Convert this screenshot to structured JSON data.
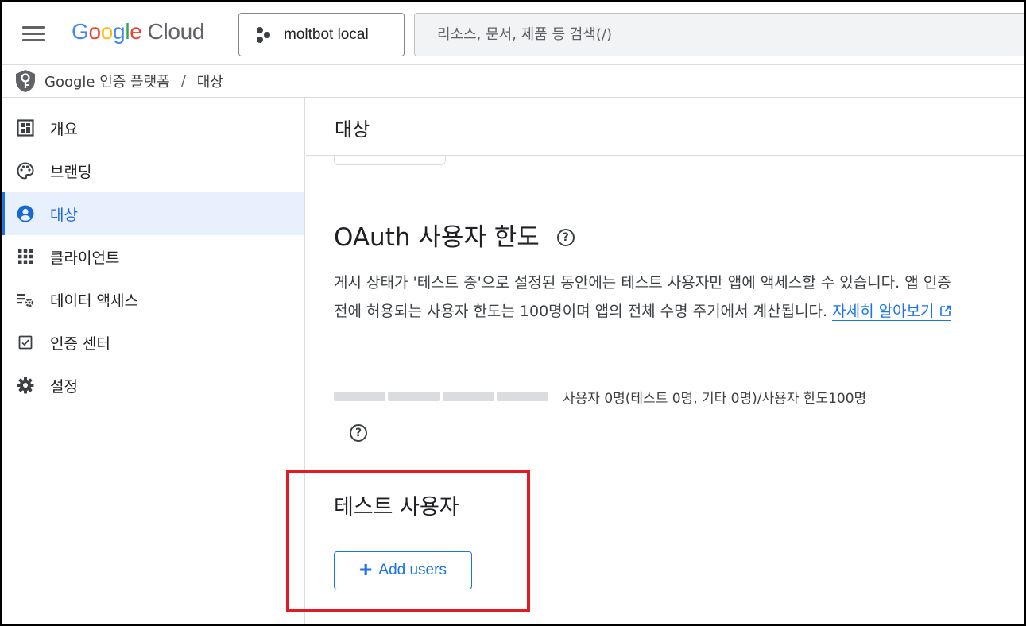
{
  "header": {
    "logo": {
      "g1": "G",
      "g2": "o",
      "g3": "o",
      "g4": "g",
      "g5": "l",
      "g6": "e",
      "product": "Cloud"
    },
    "project": "moltbot local",
    "search_placeholder": "리소스, 문서, 제품 등 검색(/)"
  },
  "breadcrumb": {
    "root": "Google 인증 플랫폼",
    "separator": "/",
    "current": "대상"
  },
  "sidebar": {
    "items": [
      {
        "label": "개요",
        "icon": "dashboard-icon"
      },
      {
        "label": "브랜딩",
        "icon": "palette-icon"
      },
      {
        "label": "대상",
        "icon": "account-circle-icon",
        "active": true
      },
      {
        "label": "클라이언트",
        "icon": "apps-grid-icon"
      },
      {
        "label": "데이터 액세스",
        "icon": "list-settings-icon"
      },
      {
        "label": "인증 센터",
        "icon": "checkbox-icon"
      },
      {
        "label": "설정",
        "icon": "gear-icon"
      }
    ]
  },
  "main": {
    "title": "대상",
    "oauth_heading": "OAuth 사용자 한도",
    "description": "게시 상태가 '테스트 중'으로 설정된 동안에는 테스트 사용자만 앱에 액세스할 수 있습니다. 앱 인증 전에 허용되는 사용자 한도는 100명이며 앱의 전체 수명 주기에서 계산됩니다.",
    "learn_more": "자세히 알아보기",
    "usage_text": "사용자 0명(테스트 0명, 기타 0명)/사용자 한도100명",
    "usage_fraction": 0,
    "test_users_heading": "테스트 사용자",
    "add_users_plus": "+",
    "add_users_label": "Add users"
  },
  "colors": {
    "accent": "#1a73e8",
    "highlight_box": "#e01b24",
    "active_nav_bg": "#e8f0fe"
  }
}
